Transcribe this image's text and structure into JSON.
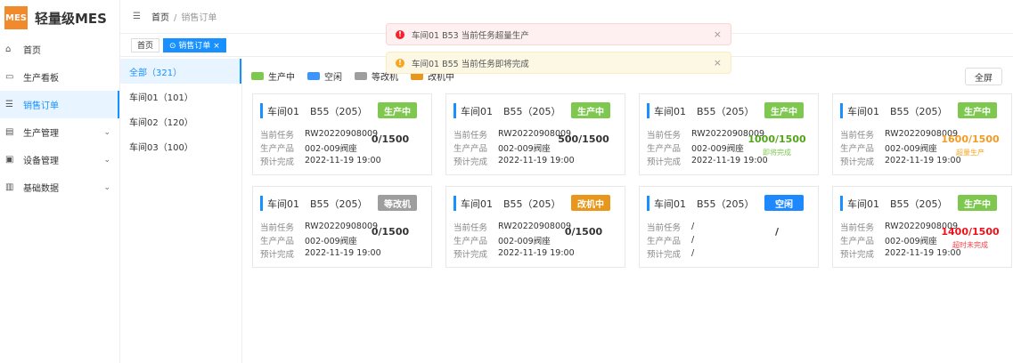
{
  "app": {
    "logo": "MES",
    "title": "轻量级MES"
  },
  "sidebar": {
    "items": [
      {
        "label": "首页",
        "icon": "home-icon",
        "glyph": "⌂"
      },
      {
        "label": "生产看板",
        "icon": "monitor-icon",
        "glyph": "▭"
      },
      {
        "label": "销售订单",
        "icon": "list-icon",
        "glyph": "☰",
        "active": true
      },
      {
        "label": "生产管理",
        "icon": "calendar-icon",
        "glyph": "▤",
        "chevron": true
      },
      {
        "label": "设备管理",
        "icon": "device-icon",
        "glyph": "▣",
        "chevron": true
      },
      {
        "label": "基础数据",
        "icon": "data-icon",
        "glyph": "▥",
        "chevron": true
      }
    ]
  },
  "header": {
    "menu_icon": "☰",
    "breadcrumb": [
      "首页",
      "销售订单"
    ],
    "sep": "/"
  },
  "tabs": [
    {
      "label": "首页"
    },
    {
      "label": "⊙ 销售订单 ×",
      "active": true
    }
  ],
  "workshops": [
    {
      "label": "全部（321）"
    },
    {
      "label": "车间01（101）"
    },
    {
      "label": "车间02（120）"
    },
    {
      "label": "车间03（100）"
    }
  ],
  "legend": [
    {
      "label": "生产中",
      "color": "#7ec850"
    },
    {
      "label": "空闲",
      "color": "#3d95ff"
    },
    {
      "label": "等改机",
      "color": "#9e9e9e"
    },
    {
      "label": "改机中",
      "color": "#e8961c"
    }
  ],
  "fullscreen": "全屏",
  "labels": {
    "task": "当前任务",
    "product": "生产产品",
    "eta": "预计完成"
  },
  "cards": [
    {
      "ws": "车间01",
      "machine": "B55（205）",
      "status": "生产中",
      "color": "#7ec850",
      "task": "RW20220908009",
      "product": "002-009阀座",
      "eta": "2022-11-19  19:00",
      "progress": "0/1500",
      "pcolor": "#333",
      "note": "",
      "ncolor": ""
    },
    {
      "ws": "车间01",
      "machine": "B55（205）",
      "status": "生产中",
      "color": "#7ec850",
      "task": "RW20220908009",
      "product": "002-009阀座",
      "eta": "2022-11-19  19:00",
      "progress": "500/1500",
      "pcolor": "#333",
      "note": "",
      "ncolor": ""
    },
    {
      "ws": "车间01",
      "machine": "B55（205）",
      "status": "生产中",
      "color": "#7ec850",
      "task": "RW20220908009",
      "product": "002-009阀座",
      "eta": "2022-11-19  19:00",
      "progress": "1000/1500",
      "pcolor": "#52a51a",
      "note": "即将完成",
      "ncolor": "#7ec850"
    },
    {
      "ws": "车间01",
      "machine": "B55（205）",
      "status": "生产中",
      "color": "#7ec850",
      "task": "RW20220908009",
      "product": "002-009阀座",
      "eta": "2022-11-19  19:00",
      "progress": "1600/1500",
      "pcolor": "#f59a23",
      "note": "超量生产",
      "ncolor": "#f5a623"
    },
    {
      "ws": "车间01",
      "machine": "B55（205）",
      "status": "等改机",
      "color": "#9e9e9e",
      "task": "RW20220908009",
      "product": "002-009阀座",
      "eta": "2022-11-19  19:00",
      "progress": "0/1500",
      "pcolor": "#333",
      "note": "",
      "ncolor": ""
    },
    {
      "ws": "车间01",
      "machine": "B55（205）",
      "status": "改机中",
      "color": "#e8961c",
      "task": "RW20220908009",
      "product": "002-009阀座",
      "eta": "2022-11-19  19:00",
      "progress": "0/1500",
      "pcolor": "#333",
      "note": "",
      "ncolor": ""
    },
    {
      "ws": "车间01",
      "machine": "B55（205）",
      "status": "空闲",
      "color": "#1e88ff",
      "task": "/",
      "product": "/",
      "eta": "/",
      "progress": "/",
      "pcolor": "#333",
      "note": "",
      "ncolor": ""
    },
    {
      "ws": "车间01",
      "machine": "B55（205）",
      "status": "生产中",
      "color": "#7ec850",
      "task": "RW20220908009",
      "product": "002-009阀座",
      "eta": "2022-11-19  19:00",
      "progress": "1400/1500",
      "pcolor": "#f0101a",
      "note": "超时未完成",
      "ncolor": "#f0404a"
    }
  ],
  "toasts": [
    {
      "text": "车间01  B53  当前任务超量生产",
      "bg": "#fef0f0",
      "border": "#fbd4d4",
      "icon_color": "#f5222d",
      "glyph": "!"
    },
    {
      "text": "车间01  B55   当前任务即将完成",
      "bg": "#fdf8e4",
      "border": "#faecc0",
      "icon_color": "#f5a623",
      "glyph": "!"
    }
  ],
  "close_glyph": "×"
}
